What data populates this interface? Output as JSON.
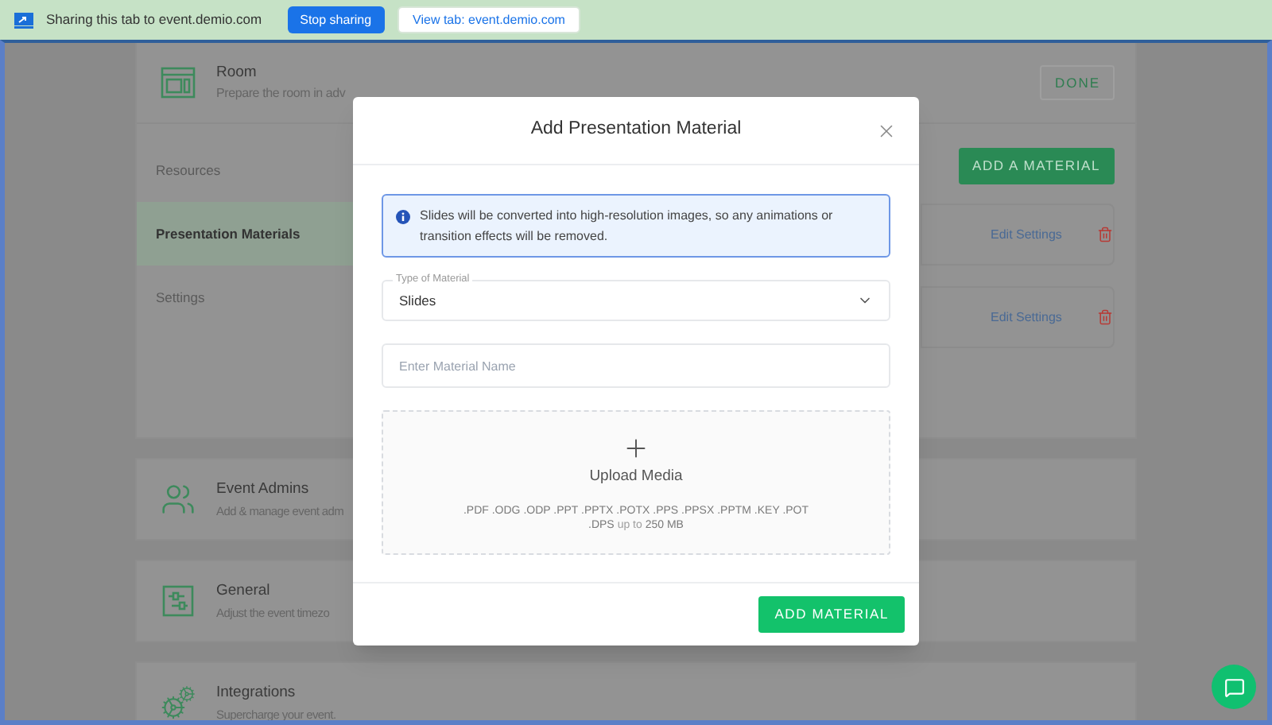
{
  "sharing_bar": {
    "message": "Sharing this tab to event.demio.com",
    "stop_button": "Stop sharing",
    "view_button": "View tab: event.demio.com"
  },
  "room_card": {
    "title": "Room",
    "subtitle": "Prepare the room in adv",
    "done_button": "DONE",
    "nav": [
      {
        "label": "Resources",
        "selected": false
      },
      {
        "label": "Presentation Materials",
        "selected": true
      },
      {
        "label": "Settings",
        "selected": false
      }
    ],
    "add_button": "ADD A MATERIAL",
    "materials": [
      {
        "action": "Edit Settings"
      },
      {
        "action": "Edit Settings"
      }
    ]
  },
  "setting_cards": [
    {
      "kind": "admins",
      "title": "Event Admins",
      "subtitle": "Add & manage event adm"
    },
    {
      "kind": "general",
      "title": "General",
      "subtitle": "Adjust the event timezo"
    },
    {
      "kind": "integrations",
      "title": "Integrations",
      "subtitle": "Supercharge your event."
    }
  ],
  "dialog": {
    "title": "Add Presentation Material",
    "notice": "Slides will be converted into high-resolution images, so any animations or transition effects will be removed.",
    "type_field": {
      "label": "Type of Material",
      "value": "Slides"
    },
    "name_field": {
      "placeholder": "Enter Material Name"
    },
    "upload": {
      "label": "Upload Media",
      "formats": ".PDF .ODG .ODP .PPT .PPTX .POTX .PPS .PPSX .PPTM .KEY .POT .DPS",
      "limit_prefix": "up to",
      "limit": "250 MB"
    },
    "submit_button": "ADD MATERIAL"
  }
}
